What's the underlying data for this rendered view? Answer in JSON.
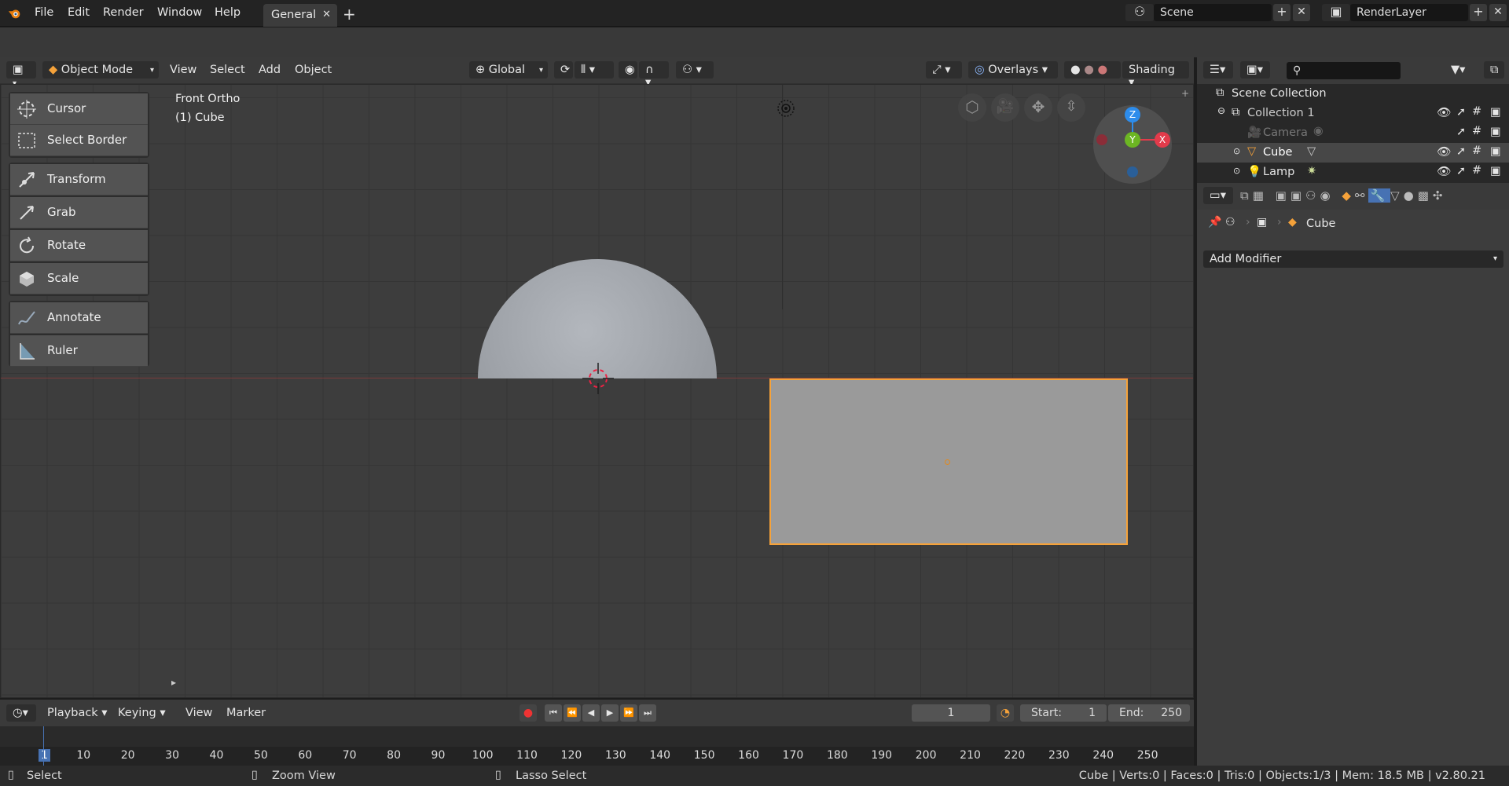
{
  "topbar": {
    "menus": [
      "File",
      "Edit",
      "Render",
      "Window",
      "Help"
    ],
    "workspace_tab": "General",
    "scene_label": "Scene",
    "renderlayer_label": "RenderLayer"
  },
  "viewport_header": {
    "mode": "Object Mode",
    "menus": [
      "View",
      "Select",
      "Add",
      "Object"
    ],
    "orientation": "Global",
    "overlays": "Overlays",
    "shading": "Shading"
  },
  "viewport": {
    "view_name": "Front Ortho",
    "object_info": "(1) Cube"
  },
  "toolbar": {
    "tools": [
      "Cursor",
      "Select Border",
      "Transform",
      "Grab",
      "Rotate",
      "Scale",
      "Annotate",
      "Ruler"
    ]
  },
  "gizmo": {
    "z": "Z",
    "y": "Y",
    "x": "X"
  },
  "outliner": {
    "scene_collection": "Scene Collection",
    "collection": "Collection 1",
    "items": [
      "Camera",
      "Cube",
      "Lamp"
    ]
  },
  "properties": {
    "object_name": "Cube",
    "add_modifier": "Add Modifier"
  },
  "timeline": {
    "menus": [
      "Playback",
      "Keying",
      "View",
      "Marker"
    ],
    "current_frame": "1",
    "start_label": "Start:",
    "start_value": "1",
    "end_label": "End:",
    "end_value": "250",
    "ruler_ticks": [
      "1",
      "10",
      "20",
      "30",
      "40",
      "50",
      "60",
      "70",
      "80",
      "90",
      "100",
      "110",
      "120",
      "130",
      "140",
      "150",
      "160",
      "170",
      "180",
      "190",
      "200",
      "210",
      "220",
      "230",
      "240",
      "250"
    ]
  },
  "statusbar": {
    "select": "Select",
    "zoom": "Zoom View",
    "lasso": "Lasso Select",
    "info": "Cube | Verts:0 | Faces:0 | Tris:0 | Objects:1/3 | Mem: 18.5 MB | v2.80.21"
  },
  "colors": {
    "accent": "#f5a23a",
    "active_blue": "#4772b3",
    "x_axis": "#e23b4b",
    "y_axis": "#6cb623",
    "z_axis": "#2d8ceb"
  }
}
